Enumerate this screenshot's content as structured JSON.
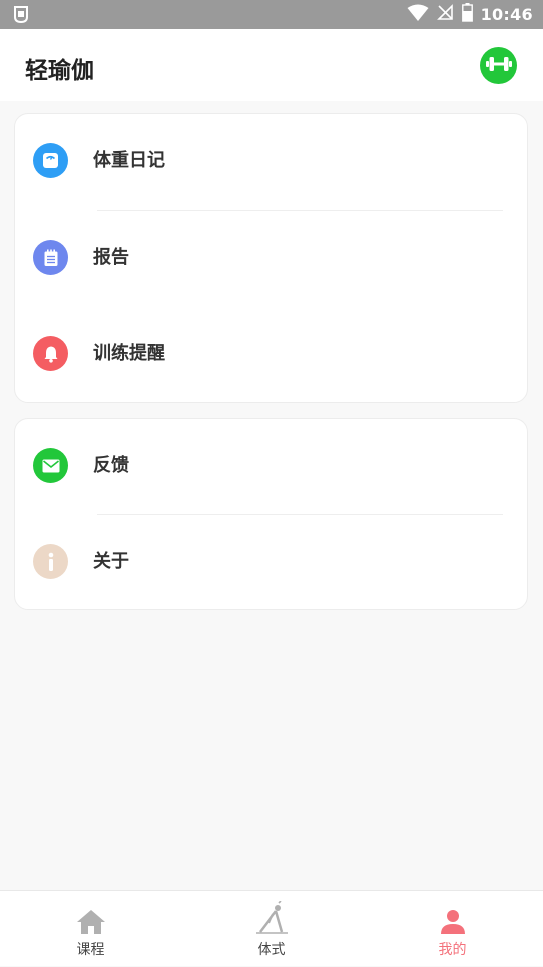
{
  "status_bar": {
    "time": "10:46",
    "icons": [
      "sim-card-icon",
      "wifi-icon",
      "no-signal-icon",
      "battery-icon"
    ]
  },
  "app_bar": {
    "title": "轻瑜伽",
    "action_icon": "dumbbell-icon",
    "action_color": "#22c73a"
  },
  "menu_groups": [
    {
      "items": [
        {
          "label": "体重日记",
          "icon": "scale-icon",
          "color": "#2e9ef5"
        },
        {
          "label": "报告",
          "icon": "notepad-icon",
          "color": "#6e87ee"
        },
        {
          "label": "训练提醒",
          "icon": "bell-icon",
          "color": "#f45d62"
        }
      ]
    },
    {
      "items": [
        {
          "label": "反馈",
          "icon": "mail-icon",
          "color": "#22c73a"
        },
        {
          "label": "关于",
          "icon": "info-icon",
          "color": "#ecd8c7"
        }
      ]
    }
  ],
  "bottom_nav": {
    "items": [
      {
        "label": "课程",
        "icon": "home-icon",
        "active": false
      },
      {
        "label": "体式",
        "icon": "yoga-pose-icon",
        "active": false
      },
      {
        "label": "我的",
        "icon": "person-icon",
        "active": true
      }
    ],
    "active_color": "#f4717b",
    "inactive_icon_color": "#b0b0b0"
  }
}
